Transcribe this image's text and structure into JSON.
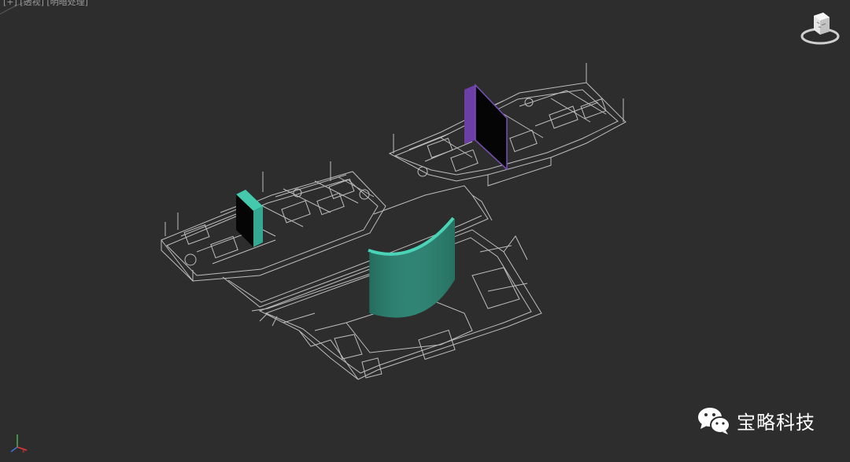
{
  "viewport": {
    "label": "[+] [透视] [明暗处理]",
    "background": "#2d2d2d",
    "plan_line_color": "#b9b9b9"
  },
  "objects": [
    {
      "name": "teal-slab",
      "color": "#3fbfa5"
    },
    {
      "name": "purple-slab",
      "color": "#6b3fa5"
    },
    {
      "name": "curved-wall",
      "color": "#2e7f6f"
    }
  ],
  "icons": {
    "view_cube": "view-cube-icon",
    "axis": "axis-tripod-icon",
    "wechat": "wechat-icon"
  },
  "watermark": {
    "text": "宝略科技"
  }
}
